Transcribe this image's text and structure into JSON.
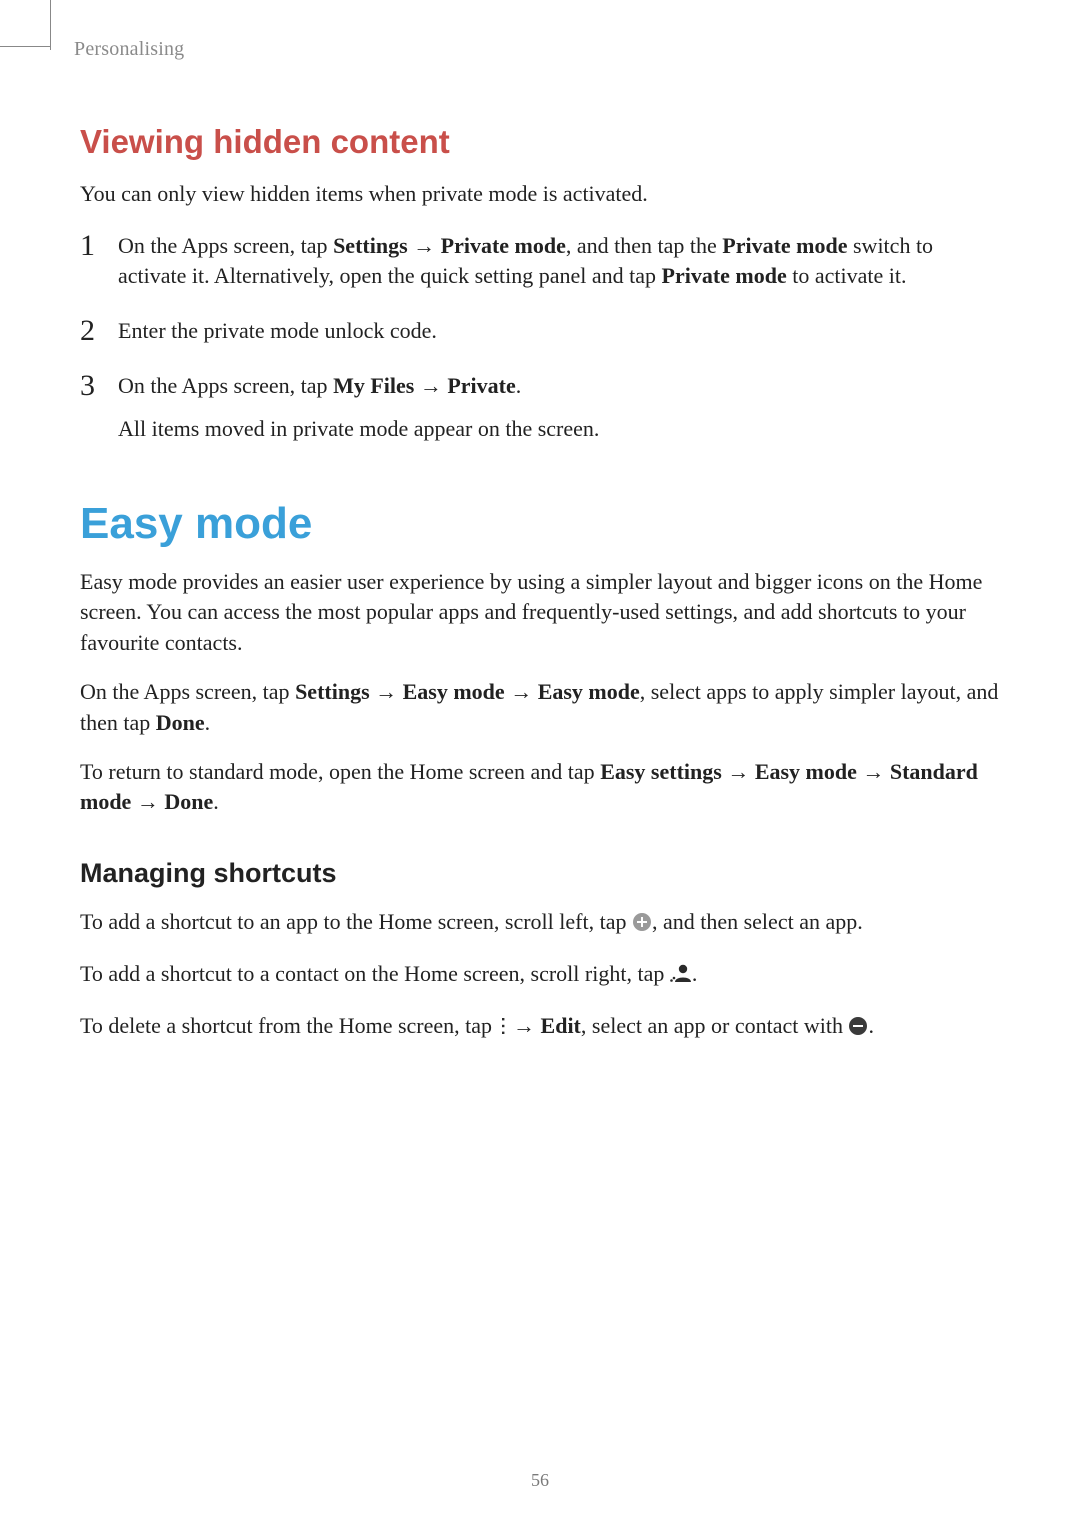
{
  "header": {
    "section_label": "Personalising"
  },
  "viewing": {
    "heading": "Viewing hidden content",
    "intro": "You can only view hidden items when private mode is activated.",
    "steps": {
      "s1": {
        "num": "1",
        "a": "On the Apps screen, tap ",
        "b1": "Settings",
        "arrow1": " → ",
        "b2": "Private mode",
        "c": ", and then tap the ",
        "b3": "Private mode",
        "d": " switch to activate it. Alternatively, open the quick setting panel and tap ",
        "b4": "Private mode",
        "e": " to activate it."
      },
      "s2": {
        "num": "2",
        "a": "Enter the private mode unlock code."
      },
      "s3": {
        "num": "3",
        "a": "On the Apps screen, tap ",
        "b1": "My Files",
        "arrow1": " → ",
        "b2": "Private",
        "c": ".",
        "p2": "All items moved in private mode appear on the screen."
      }
    }
  },
  "easy": {
    "heading": "Easy mode",
    "p1": "Easy mode provides an easier user experience by using a simpler layout and bigger icons on the Home screen. You can access the most popular apps and frequently-used settings, and add shortcuts to your favourite contacts.",
    "p2": {
      "a": "On the Apps screen, tap ",
      "b1": "Settings",
      "arrow1": " → ",
      "b2": "Easy mode",
      "arrow2": " → ",
      "b3": "Easy mode",
      "c": ", select apps to apply simpler layout, and then tap ",
      "b4": "Done",
      "d": "."
    },
    "p3": {
      "a": "To return to standard mode, open the Home screen and tap ",
      "b1": "Easy settings",
      "arrow1": " → ",
      "b2": "Easy mode",
      "arrow2": " → ",
      "b3": "Standard mode",
      "arrow3": " → ",
      "b4": "Done",
      "d": "."
    },
    "shortcuts": {
      "heading": "Managing shortcuts",
      "p1": {
        "a": "To add a shortcut to an app to the Home screen, scroll left, tap ",
        "b": ", and then select an app."
      },
      "p2": {
        "a": "To add a shortcut to a contact on the Home screen, scroll right, tap ",
        "b": "."
      },
      "p3": {
        "a": "To delete a shortcut from the Home screen, tap ",
        "arrow1": " → ",
        "b1": "Edit",
        "c": ", select an app or contact with ",
        "d": "."
      }
    }
  },
  "page_number": "56"
}
